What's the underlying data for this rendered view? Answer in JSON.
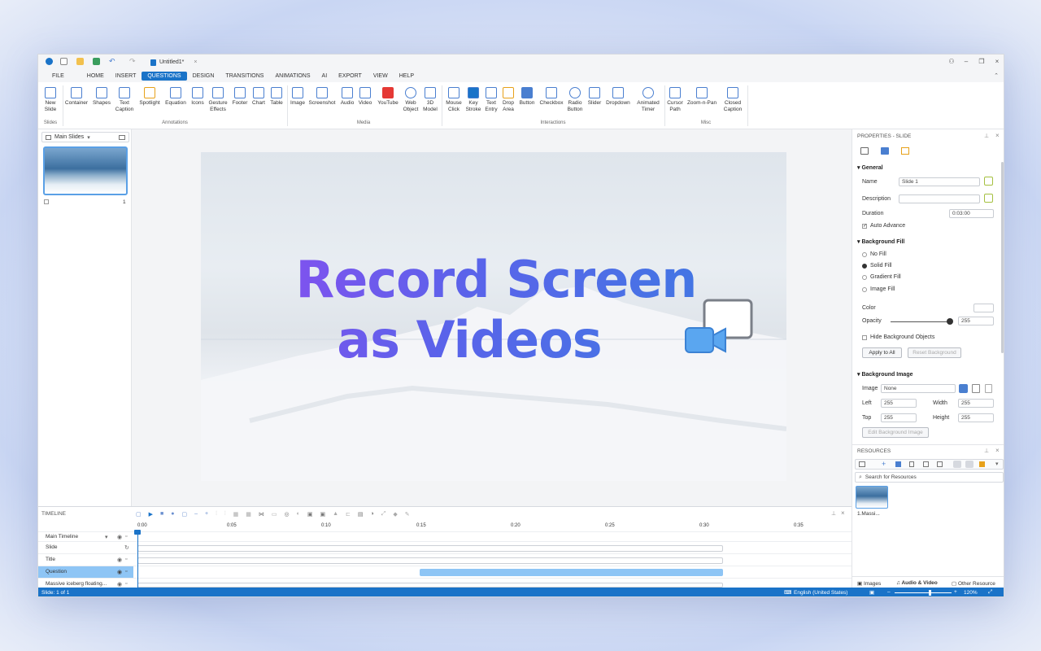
{
  "title_bar": {
    "doc_title": "Untitled1*"
  },
  "menu": [
    "FILE",
    "HOME",
    "INSERT",
    "QUESTIONS",
    "DESIGN",
    "TRANSITIONS",
    "ANIMATIONS",
    "AI",
    "EXPORT",
    "VIEW",
    "HELP"
  ],
  "ribbon": {
    "slides": {
      "new_slide": "New Slide",
      "group": "Slides"
    },
    "annotations": {
      "items": [
        "Container",
        "Shapes",
        "Text Caption",
        "Spotlight",
        "Equation",
        "Icons",
        "Gesture Effects",
        "Footer",
        "Chart",
        "Table"
      ],
      "group": "Annotations"
    },
    "media": {
      "items": [
        "Image",
        "Screenshot",
        "Audio",
        "Video",
        "YouTube",
        "Web Object",
        "3D Model"
      ],
      "group": "Media"
    },
    "interactions": {
      "items": [
        "Mouse Click",
        "Key Stroke",
        "Text Entry",
        "Drop Area",
        "Button",
        "Checkbox",
        "Radio Button",
        "Slider",
        "Dropdown",
        "Animated Timer"
      ],
      "group": "Interactions"
    },
    "misc": {
      "items": [
        "Cursor Path",
        "Zoom-n-Pan",
        "Closed Caption"
      ],
      "group": "Misc"
    }
  },
  "slides_panel": {
    "header": "Main Slides",
    "slide_number": "1"
  },
  "slide": {
    "headline_line1": "Record Screen",
    "headline_line2": "as Videos"
  },
  "properties": {
    "header": "PROPERTIES - SLIDE",
    "general": "General",
    "name_label": "Name",
    "name_value": "Slide 1",
    "description_label": "Description",
    "description_value": "",
    "duration_label": "Duration",
    "duration_value": "0:03:00",
    "auto_advance": "Auto Advance",
    "background_fill": "Background Fill",
    "fill_options": [
      "No Fill",
      "Solid Fill",
      "Gradient Fill",
      "Image Fill"
    ],
    "color_label": "Color",
    "opacity_label": "Opacity",
    "opacity_value": "255",
    "hide_bg_objects": "Hide Background Objects",
    "apply_to_all": "Apply to All",
    "reset_background": "Reset Background",
    "background_image": "Background Image",
    "image_label": "Image",
    "image_value": "None",
    "left_label": "Left",
    "left_value": "255",
    "width_label": "Width",
    "width_value": "255",
    "top_label": "Top",
    "top_value": "255",
    "height_label": "Height",
    "height_value": "255",
    "edit_bg_image": "Edit Background Image"
  },
  "resources": {
    "header": "RESOURCES",
    "search_placeholder": "Search for Resources",
    "item_label": "1.Massi...",
    "tabs": [
      "Images",
      "Audio & Video",
      "Other Resource"
    ]
  },
  "timeline": {
    "header": "TIMELINE",
    "ticks": [
      "0:00",
      "0:05",
      "0:10",
      "0:15",
      "0:20",
      "0:25",
      "0:30",
      "0:35"
    ],
    "rows": [
      "Main Timeline",
      "Slide",
      "Title",
      "Question",
      "Massive iceberg floating..."
    ],
    "question_bar_start": 0.482,
    "question_bar_end": 1.0
  },
  "status": {
    "slide": "Slide: 1 of 1",
    "language": "English (United States)",
    "zoom": "120%"
  },
  "colors": {
    "accent": "#1a73c8",
    "selected_row": "#8ec5f5"
  }
}
